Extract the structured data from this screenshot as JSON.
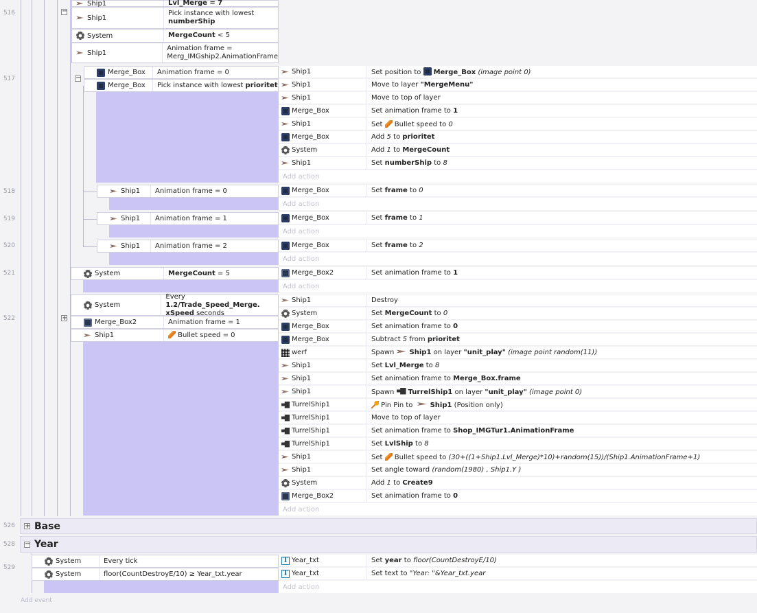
{
  "line_numbers": {
    "l516": "516",
    "l517": "517",
    "l518": "518",
    "l519": "519",
    "l520": "520",
    "l521": "521",
    "l522": "522",
    "l526": "526",
    "l528": "528",
    "l529": "529"
  },
  "e516": {
    "c1_obj": "Ship1",
    "c1_txt": "Lvl_Merge = 7",
    "c2_obj": "Ship1",
    "c2_txt_a": "Pick instance with lowest",
    "c2_txt_b": "numberShip",
    "c3_obj": "System",
    "c3_txt_a": "MergeCount",
    "c3_txt_b": " < 5",
    "c4_obj": "Ship1",
    "c4_txt_a": "Animation frame =",
    "c4_txt_b": "Merg_IMGship2.AnimationFrame"
  },
  "e517": {
    "c1_obj": "Merge_Box",
    "c1_txt": "Animation frame = 0",
    "c2_obj": "Merge_Box",
    "c2_txt_a": "Pick instance with lowest ",
    "c2_txt_b": "prioritet",
    "a1_obj": "Ship1",
    "a1_a": "Set position to ",
    "a1_b": "Merge_Box",
    "a1_c": " (image point 0)",
    "a2_obj": "Ship1",
    "a2_a": "Move to layer ",
    "a2_b": "\"MergeMenu\"",
    "a3_obj": "Ship1",
    "a3_a": "Move to top of layer",
    "a4_obj": "Merge_Box",
    "a4_a": "Set animation frame to ",
    "a4_b": "1",
    "a5_obj": "Ship1",
    "a5_a": "Set ",
    "a5_b": " Bullet speed to ",
    "a5_c": "0",
    "a6_obj": "Merge_Box",
    "a6_a": "Add ",
    "a6_b": "5",
    "a6_c": " to ",
    "a6_d": "prioritet",
    "a7_obj": "System",
    "a7_a": "Add ",
    "a7_b": "1",
    "a7_c": " to ",
    "a7_d": "MergeCount",
    "a8_obj": "Ship1",
    "a8_a": "Set ",
    "a8_b": "numberShip",
    "a8_c": " to ",
    "a8_d": "8"
  },
  "e518": {
    "c_obj": "Ship1",
    "c_txt": "Animation frame = 0",
    "a_obj": "Merge_Box",
    "a_a": "Set ",
    "a_b": "frame",
    "a_c": " to ",
    "a_d": "0"
  },
  "e519": {
    "c_obj": "Ship1",
    "c_txt": "Animation frame = 1",
    "a_obj": "Merge_Box",
    "a_a": "Set ",
    "a_b": "frame",
    "a_c": " to ",
    "a_d": "1"
  },
  "e520": {
    "c_obj": "Ship1",
    "c_txt": "Animation frame = 2",
    "a_obj": "Merge_Box",
    "a_a": "Set ",
    "a_b": "frame",
    "a_c": " to ",
    "a_d": "2"
  },
  "e521": {
    "c_obj": "System",
    "c_txt_a": "MergeCount",
    "c_txt_b": " = 5",
    "a_obj": "Merge_Box2",
    "a_a": "Set animation frame to ",
    "a_b": "1"
  },
  "e522": {
    "c1_obj": "System",
    "c1_a": "Every ",
    "c1_b": "1.2/Trade_Speed_Merge.",
    "c1_c": "xSpeed",
    "c1_d": " seconds",
    "c2_obj": "Merge_Box2",
    "c2_txt": "Animation frame = 1",
    "c3_obj": "Ship1",
    "c3_txt": " Bullet speed = 0",
    "a1_obj": "Ship1",
    "a1_a": "Destroy",
    "a2_obj": "System",
    "a2_a": "Set ",
    "a2_b": "MergeCount",
    "a2_c": " to ",
    "a2_d": "0",
    "a3_obj": "Merge_Box",
    "a3_a": "Set animation frame to ",
    "a3_b": "0",
    "a4_obj": "Merge_Box",
    "a4_a": "Subtract ",
    "a4_b": "5",
    "a4_c": " from ",
    "a4_d": "prioritet",
    "a5_obj": "werf",
    "a5_a": "Spawn ",
    "a5_b": "Ship1",
    "a5_c": " on layer ",
    "a5_d": "\"unit_play\"",
    "a5_e": " (image point random(11))",
    "a6_obj": "Ship1",
    "a6_a": "Set ",
    "a6_b": "Lvl_Merge",
    "a6_c": " to ",
    "a6_d": "8",
    "a7_obj": "Ship1",
    "a7_a": "Set animation frame to ",
    "a7_b": "Merge_Box.frame",
    "a8_obj": "Ship1",
    "a8_a": "Spawn ",
    "a8_b": "TurrelShip1",
    "a8_c": " on layer ",
    "a8_d": "\"unit_play\"",
    "a8_e": " (image point 0)",
    "a9_obj": "TurrelShip1",
    "a9_a": " Pin Pin to ",
    "a9_b": "Ship1",
    "a9_c": " (Position only)",
    "a10_obj": "TurrelShip1",
    "a10_a": "Move to top of layer",
    "a11_obj": "TurrelShip1",
    "a11_a": "Set animation frame to ",
    "a11_b": "Shop_IMGTur1.AnimationFrame",
    "a12_obj": "TurrelShip1",
    "a12_a": "Set ",
    "a12_b": "LvlShip",
    "a12_c": " to ",
    "a12_d": "8",
    "a13_obj": "Ship1",
    "a13_a": "Set ",
    "a13_b": " Bullet speed to ",
    "a13_c": "(30+((1+Ship1.Lvl_Merge)*10)+random(15))/(Ship1.AnimationFrame+1)",
    "a14_obj": "Ship1",
    "a14_a": "Set angle toward ",
    "a14_b": "(random(1980) , Ship1.Y )",
    "a15_obj": "System",
    "a15_a": "Add ",
    "a15_b": "1",
    "a15_c": " to ",
    "a15_d": "Create9",
    "a16_obj": "Merge_Box2",
    "a16_a": "Set animation frame to ",
    "a16_b": "0"
  },
  "groups": {
    "base": "Base",
    "year": "Year"
  },
  "e529": {
    "c1_obj": "System",
    "c1_txt": "Every tick",
    "c2_obj": "System",
    "c2_txt": "floor(CountDestroyE/10) ≥ Year_txt.year",
    "a1_obj": "Year_txt",
    "a1_a": "Set ",
    "a1_b": "year",
    "a1_c": " to ",
    "a1_d": "floor(CountDestroyE/10)",
    "a2_obj": "Year_txt",
    "a2_a": "Set text to ",
    "a2_b": "\"Year: \"&Year_txt.year"
  },
  "labels": {
    "add_action": "Add action",
    "add_event": "Add event",
    "expand": "+",
    "collapse": "−"
  }
}
